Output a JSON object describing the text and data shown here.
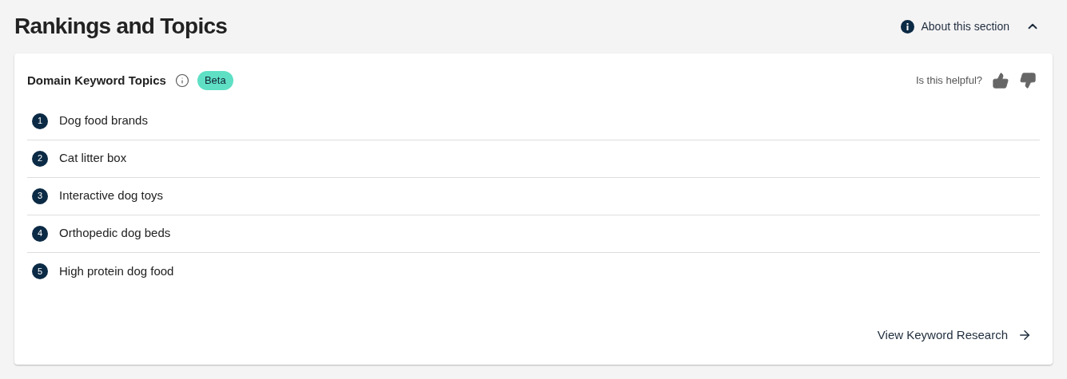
{
  "section": {
    "title": "Rankings and Topics",
    "about_link": "About this section",
    "expanded": true
  },
  "card": {
    "title": "Domain Keyword Topics",
    "badge": "Beta",
    "feedback_prompt": "Is this helpful?",
    "topics": [
      {
        "number": "1",
        "label": "Dog food brands"
      },
      {
        "number": "2",
        "label": "Cat litter box"
      },
      {
        "number": "3",
        "label": "Interactive dog toys"
      },
      {
        "number": "4",
        "label": "Orthopedic dog beds"
      },
      {
        "number": "5",
        "label": "High protein dog food"
      }
    ],
    "footer_link": "View Keyword Research"
  }
}
